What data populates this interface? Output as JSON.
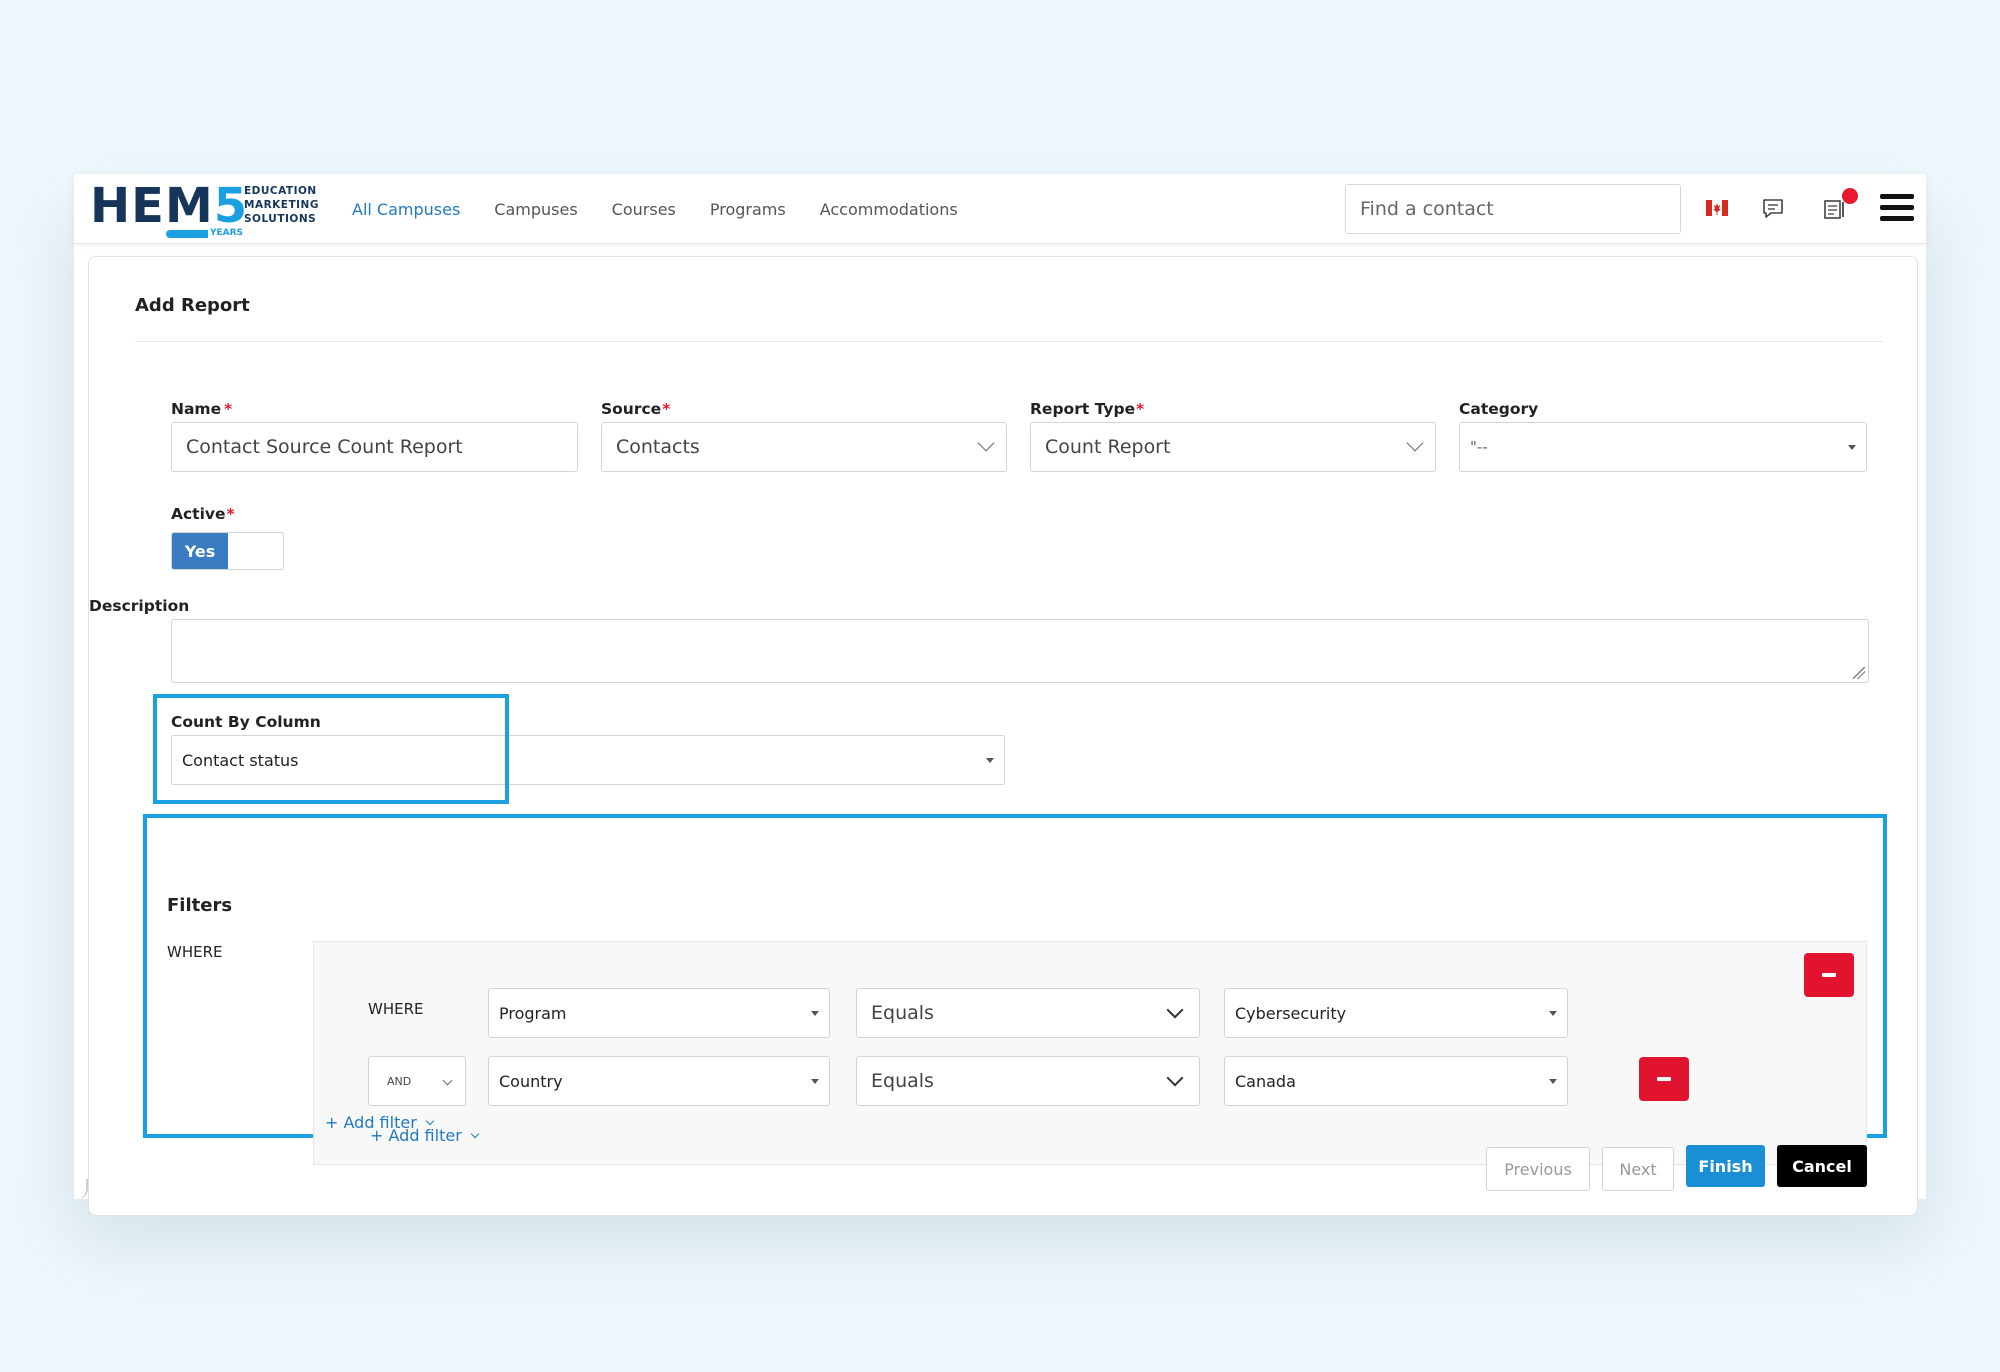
{
  "header": {
    "logo_main": "HEM",
    "logo_five": "5",
    "logo_line1": "EDUCATION",
    "logo_line2": "MARKETING",
    "logo_line3": "SOLUTIONS",
    "logo_years": "YEARS",
    "nav": [
      "All Campuses",
      "Campuses",
      "Courses",
      "Programs",
      "Accommodations"
    ],
    "active_nav": "All Campuses",
    "search_placeholder": "Find a contact",
    "icons": [
      "canada-flag-icon",
      "chat-icon",
      "notes-icon",
      "menu-icon"
    ]
  },
  "form": {
    "title": "Add Report",
    "name_label": "Name",
    "name_value": "Contact Source Count Report",
    "source_label": "Source",
    "source_value": "Contacts",
    "report_type_label": "Report Type",
    "report_type_value": "Count Report",
    "category_label": "Category",
    "category_value": "\"--",
    "active_label": "Active",
    "active_value": "Yes",
    "description_label": "Description",
    "description_value": "",
    "count_by_label": "Count By Column",
    "count_by_value": "Contact status",
    "required_mark": "*"
  },
  "filters": {
    "title": "Filters",
    "outer_where": "WHERE",
    "rows": [
      {
        "connector": "WHERE",
        "field": "Program",
        "operator": "Equals",
        "value": "Cybersecurity"
      },
      {
        "connector": "AND",
        "field": "Country",
        "operator": "Equals",
        "value": "Canada"
      }
    ],
    "add_filter_label": "+ Add filter"
  },
  "footer": {
    "previous": "Previous",
    "next": "Next",
    "finish": "Finish",
    "cancel": "Cancel"
  },
  "colors": {
    "accent": "#1a9fe0",
    "link": "#1f7ac2",
    "danger": "#e2132f",
    "toggle_on": "#3a7cc2"
  }
}
